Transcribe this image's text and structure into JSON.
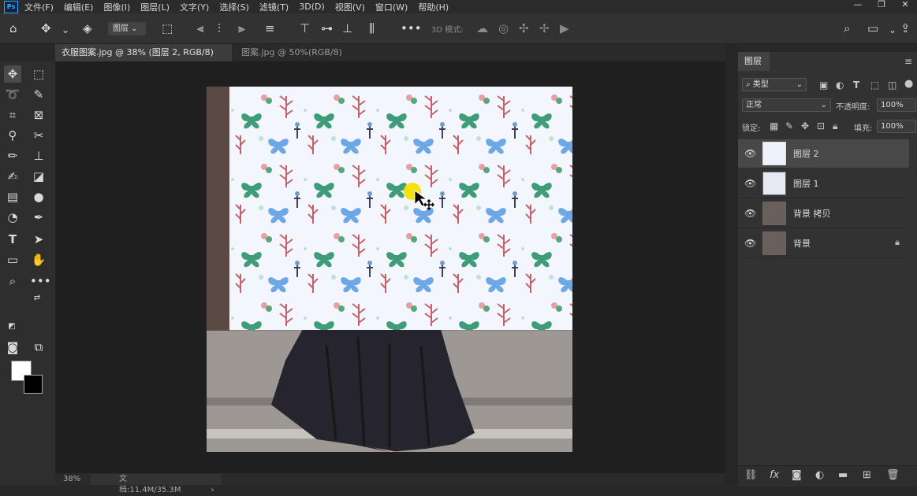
{
  "app": {
    "logo": "Ps"
  },
  "menu": [
    "文件(F)",
    "编辑(E)",
    "图像(I)",
    "图层(L)",
    "文字(Y)",
    "选择(S)",
    "滤镜(T)",
    "3D(D)",
    "视图(V)",
    "窗口(W)",
    "帮助(H)"
  ],
  "window_controls": [
    "—",
    "❐",
    "✕"
  ],
  "options_bar": {
    "layer_select": "图层",
    "mode_3d": "3D 模式:"
  },
  "tabs": [
    {
      "label": "衣服图案.jpg @ 38% (图层 2, RGB/8) *",
      "close": "×",
      "active": true
    },
    {
      "label": "图案.jpg @ 50%(RGB/8) *",
      "close": "×",
      "active": false
    }
  ],
  "status": {
    "zoom": "38%",
    "doc": "文档:11.4M/35.3M",
    "arrow": "›"
  },
  "colors": {
    "foreground": "#ffffff",
    "background": "#000000",
    "highlight": "#f4e20f"
  },
  "layers_panel": {
    "title": "图层",
    "filter": "类型",
    "blend_mode": "正常",
    "opacity_label": "不透明度:",
    "opacity": "100%",
    "lock_label": "锁定:",
    "fill_label": "填充:",
    "fill": "100%",
    "layers": [
      {
        "name": "图层 2",
        "selected": true,
        "locked": false
      },
      {
        "name": "图层 1",
        "selected": false,
        "locked": false
      },
      {
        "name": "背景 拷贝",
        "selected": false,
        "locked": false
      },
      {
        "name": "背景",
        "selected": false,
        "locked": true
      }
    ]
  }
}
